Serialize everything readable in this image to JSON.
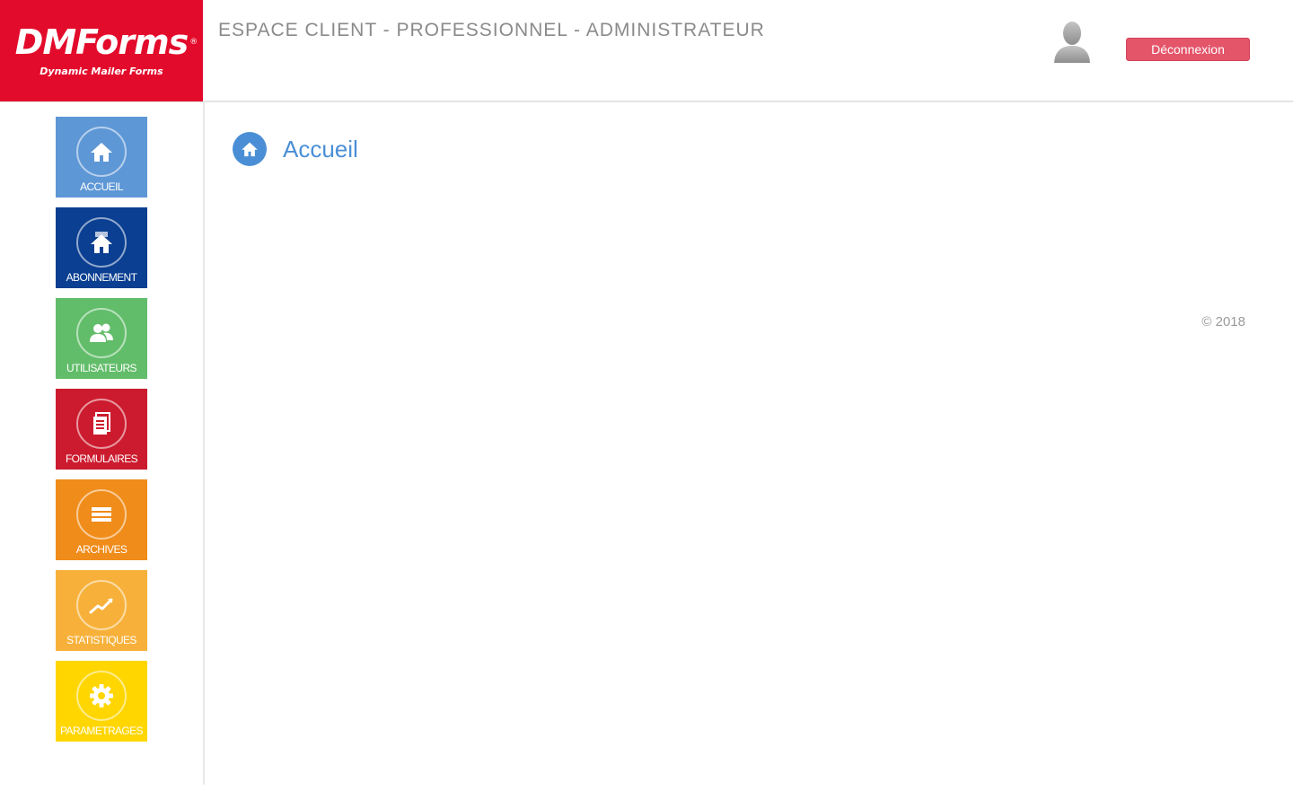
{
  "header": {
    "logo_name": "DMForms",
    "logo_registered": "®",
    "logo_tagline": "Dynamic Mailer Forms",
    "title": "ESPACE CLIENT - PROFESSIONNEL - ADMINISTRATEUR",
    "logout_label": "Déconnexion",
    "avatar_icon": "user-silhouette-icon"
  },
  "sidebar": {
    "items": [
      {
        "label": "ACCUEIL",
        "icon": "home-icon",
        "color": "#5e97d6"
      },
      {
        "label": "ABONNEMENT",
        "icon": "house-card-icon",
        "color": "#0a3f91"
      },
      {
        "label": "UTILISATEURS",
        "icon": "users-icon",
        "color": "#62bd6a"
      },
      {
        "label": "FORMULAIRES",
        "icon": "document-icon",
        "color": "#cc1b2e"
      },
      {
        "label": "ARCHIVES",
        "icon": "list-icon",
        "color": "#f08c1a"
      },
      {
        "label": "STATISTIQUES",
        "icon": "trend-line-icon",
        "color": "#f7b13a"
      },
      {
        "label": "PARAMETRAGES",
        "icon": "gear-icon",
        "color": "#ffd600"
      }
    ]
  },
  "main": {
    "page_title": "Accueil",
    "page_title_icon": "home-icon",
    "accent_color": "#4a8fd6"
  },
  "footer": {
    "copyright": "© 2018"
  },
  "colors": {
    "brand_red": "#e30b2b",
    "logout_button": "#e4556a"
  }
}
